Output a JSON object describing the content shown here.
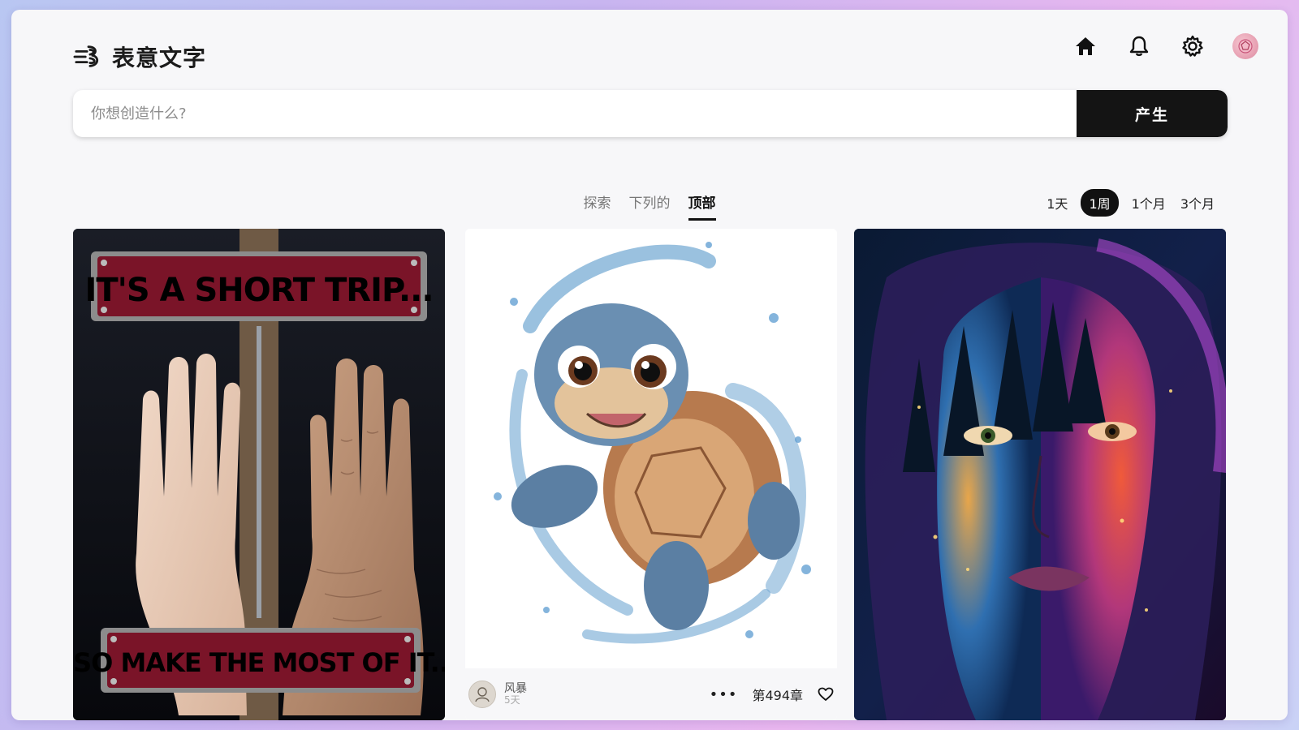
{
  "app": {
    "logo_text": "表意文字"
  },
  "header": {
    "icons": [
      "home-icon",
      "bell-icon",
      "gear-icon",
      "avatar"
    ]
  },
  "search": {
    "placeholder": "你想创造什么?",
    "value": "",
    "button_label": "产生"
  },
  "tabs": [
    {
      "label": "探索",
      "active": false
    },
    {
      "label": "下列的",
      "active": false
    },
    {
      "label": "顶部",
      "active": true
    }
  ],
  "ranges": [
    {
      "label": "1天",
      "active": false
    },
    {
      "label": "1周",
      "active": true
    },
    {
      "label": "1个月",
      "active": false
    },
    {
      "label": "3个月",
      "active": false
    }
  ],
  "cards": [
    {
      "sign_top": "IT'S A SHORT TRIP...",
      "sign_bottom": "SO MAKE THE MOST OF IT.."
    },
    {
      "user_name": "风暴",
      "time": "5天",
      "rank": "第494章"
    },
    {}
  ],
  "colors": {
    "accent": "#141414",
    "sign_red": "#7a1428"
  }
}
